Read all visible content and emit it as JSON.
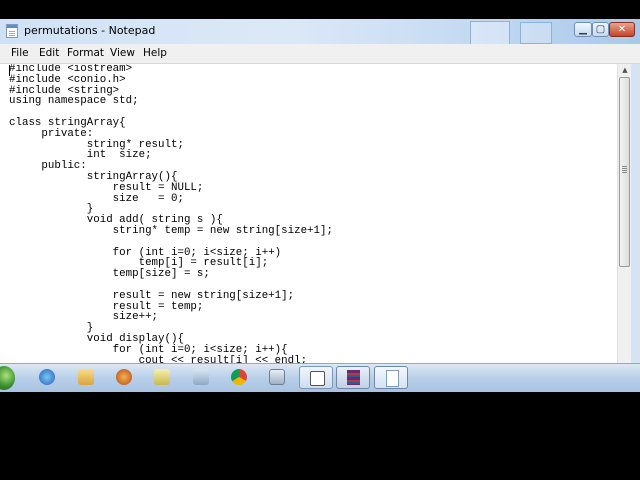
{
  "window": {
    "title": "permutations - Notepad",
    "buttons": {
      "minimize": "▁",
      "maximize": "▢",
      "close": "✕"
    }
  },
  "menu": [
    "File",
    "Edit",
    "Format",
    "View",
    "Help"
  ],
  "editor": {
    "text": "#include <iostream>\n#include <conio.h>\n#include <string>\nusing namespace std;\n\nclass stringArray{\n     private:\n            string* result;\n            int  size;\n     public:\n            stringArray(){\n                result = NULL;\n                size   = 0;\n            }\n            void add( string s ){\n                string* temp = new string[size+1];\n\n                for (int i=0; i<size; i++)\n                    temp[i] = result[i];\n                temp[size] = s;\n\n                result = new string[size+1];\n                result = temp;\n                size++;\n            }\n            void display(){\n                for (int i=0; i<size; i++){\n                    cout << result[i] << endl;"
  },
  "scrollbar": {
    "up_arrow": "▲"
  },
  "taskbar": {
    "icons": [
      "start-orb",
      "internet-explorer-icon",
      "file-explorer-icon",
      "media-player-icon",
      "app-icon",
      "app-icon",
      "chrome-icon",
      "app-icon",
      "app-icon",
      "winrar-icon",
      "notepad-icon"
    ]
  },
  "colors": {
    "titlebar": "#cfe2f5",
    "menubar": "#f0f0f0",
    "editor_bg": "#ffffff",
    "taskbar": "#b8cfe8",
    "close_button": "#c4432b"
  }
}
